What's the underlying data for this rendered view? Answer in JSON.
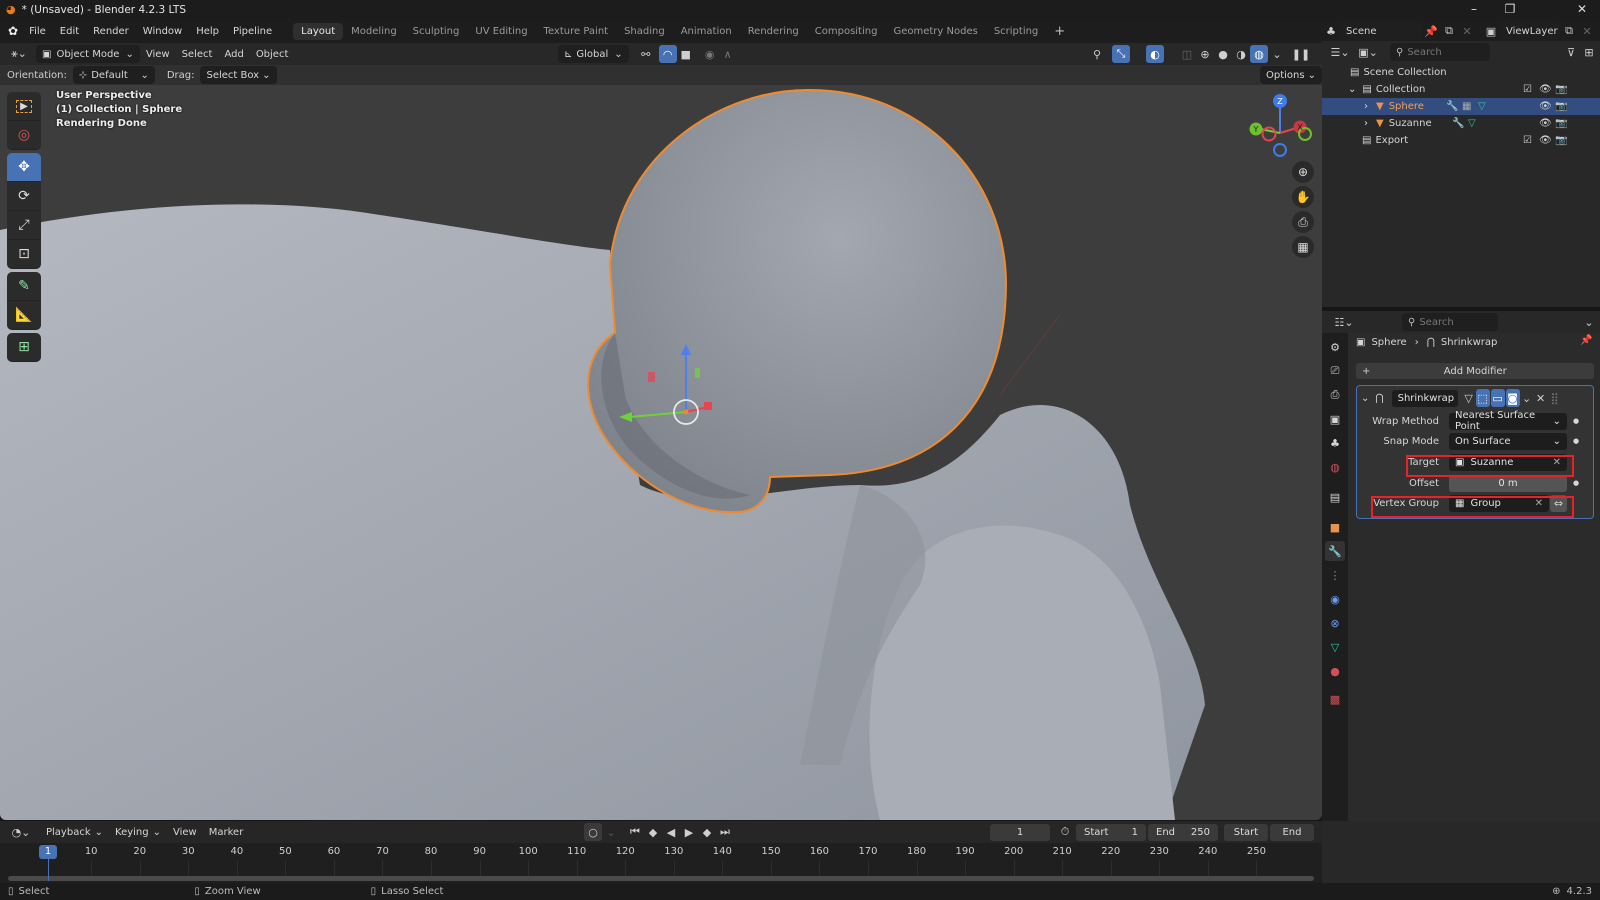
{
  "window": {
    "title": "* (Unsaved) - Blender 4.2.3 LTS",
    "controls": {
      "minimize": "–",
      "maximize": "❐",
      "close": "✕"
    }
  },
  "menubar": {
    "items": [
      "File",
      "Edit",
      "Render",
      "Window",
      "Help",
      "Pipeline"
    ],
    "workspaces": [
      "Layout",
      "Modeling",
      "Sculpting",
      "UV Editing",
      "Texture Paint",
      "Shading",
      "Animation",
      "Rendering",
      "Compositing",
      "Geometry Nodes",
      "Scripting"
    ],
    "active_workspace": "Layout",
    "add_workspace": "+",
    "scene": "Scene",
    "view_layer": "ViewLayer"
  },
  "viewport_header": {
    "mode": "Object Mode",
    "menus": [
      "View",
      "Select",
      "Add",
      "Object"
    ],
    "transform_orientation": "Global",
    "options_label": "Options"
  },
  "tool_header": {
    "orientation_label": "Orientation:",
    "orientation_value": "Default",
    "drag_label": "Drag:",
    "drag_value": "Select Box"
  },
  "viewport_overlay": {
    "line1": "User Perspective",
    "line2": "(1) Collection | Sphere",
    "line3": "Rendering Done"
  },
  "gizmo": {
    "z": "Z",
    "y": "Y",
    "x": "X"
  },
  "outliner": {
    "search_placeholder": "Search",
    "rows": [
      {
        "label": "Scene Collection"
      },
      {
        "label": "Collection"
      },
      {
        "label": "Sphere",
        "selected": true
      },
      {
        "label": "Suzanne"
      },
      {
        "label": "Export"
      }
    ]
  },
  "properties": {
    "search_placeholder": "Search",
    "breadcrumb_object": "Sphere",
    "breadcrumb_modifier": "Shrinkwrap",
    "add_modifier": "Add Modifier",
    "modifier": {
      "name": "Shrinkwrap",
      "fields": [
        {
          "label": "Wrap Method",
          "value": "Nearest Surface Point"
        },
        {
          "label": "Snap Mode",
          "value": "On Surface"
        },
        {
          "label": "Target",
          "value": "Suzanne"
        },
        {
          "label": "Offset",
          "value": "0 m"
        },
        {
          "label": "Vertex Group",
          "value": "Group"
        }
      ]
    }
  },
  "timeline": {
    "menus": [
      "Playback",
      "Keying",
      "View",
      "Marker"
    ],
    "current_frame": "1",
    "start_label": "Start",
    "start_value": "1",
    "end_label": "End",
    "end_value": "250",
    "start_btn": "Start",
    "end_btn": "End",
    "ticks": [
      "10",
      "20",
      "30",
      "40",
      "50",
      "60",
      "70",
      "80",
      "90",
      "100",
      "110",
      "120",
      "130",
      "140",
      "150",
      "160",
      "170",
      "180",
      "190",
      "200",
      "210",
      "220",
      "230",
      "240",
      "250"
    ],
    "playhead": "1"
  },
  "statusbar": {
    "select": "Select",
    "zoom_view": "Zoom View",
    "lasso_select": "Lasso Select",
    "version": "4.2.3"
  }
}
